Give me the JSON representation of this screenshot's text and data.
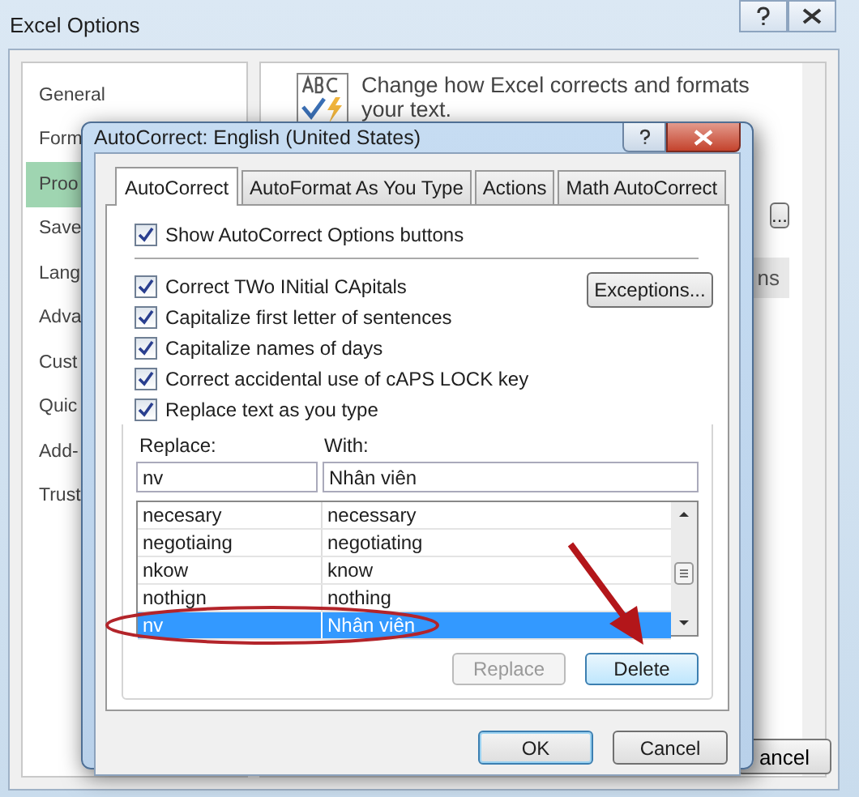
{
  "options_window": {
    "title": "Excel Options",
    "sidebar": [
      {
        "label": "General",
        "selected": false
      },
      {
        "label": "Form",
        "selected": false
      },
      {
        "label": "Proo",
        "selected": true
      },
      {
        "label": "Save",
        "selected": false
      },
      {
        "label": "Lang",
        "selected": false
      },
      {
        "label": "Adva",
        "selected": false
      },
      {
        "label": "Cust",
        "selected": false
      },
      {
        "label": "Quic",
        "selected": false
      },
      {
        "label": "Add-",
        "selected": false
      },
      {
        "label": "Trust",
        "selected": false
      }
    ],
    "intro_text": "Change how Excel corrects and formats your text.",
    "button_fragments": [
      "...",
      "ns"
    ],
    "cancel_fragment": "ancel"
  },
  "dialog": {
    "title": "AutoCorrect: English (United States)",
    "tabs": [
      {
        "label": "AutoCorrect",
        "selected": true
      },
      {
        "label": "AutoFormat As You Type",
        "selected": false
      },
      {
        "label": "Actions",
        "selected": false
      },
      {
        "label": "Math AutoCorrect",
        "selected": false
      }
    ],
    "show_buttons_option": {
      "label": "Show AutoCorrect Options buttons",
      "checked": true
    },
    "options": [
      {
        "label": "Correct TWo INitial CApitals",
        "checked": true
      },
      {
        "label": "Capitalize first letter of sentences",
        "checked": true
      },
      {
        "label": "Capitalize names of days",
        "checked": true
      },
      {
        "label": "Correct accidental use of cAPS LOCK key",
        "checked": true
      }
    ],
    "exceptions_button": "Exceptions...",
    "replace_option": {
      "label": "Replace text as you type",
      "checked": true
    },
    "replace_label": "Replace:",
    "with_label": "With:",
    "replace_value": "nv",
    "with_value": "Nhân viên",
    "entries": [
      {
        "replace": "necesary",
        "with": "necessary",
        "selected": false
      },
      {
        "replace": "negotiaing",
        "with": "negotiating",
        "selected": false
      },
      {
        "replace": "nkow",
        "with": "know",
        "selected": false
      },
      {
        "replace": "nothign",
        "with": "nothing",
        "selected": false
      },
      {
        "replace": "nv",
        "with": "Nhân viên",
        "selected": true
      }
    ],
    "replace_button": {
      "label": "Replace",
      "disabled": true
    },
    "delete_button": "Delete",
    "ok_button": "OK",
    "cancel_button": "Cancel"
  }
}
